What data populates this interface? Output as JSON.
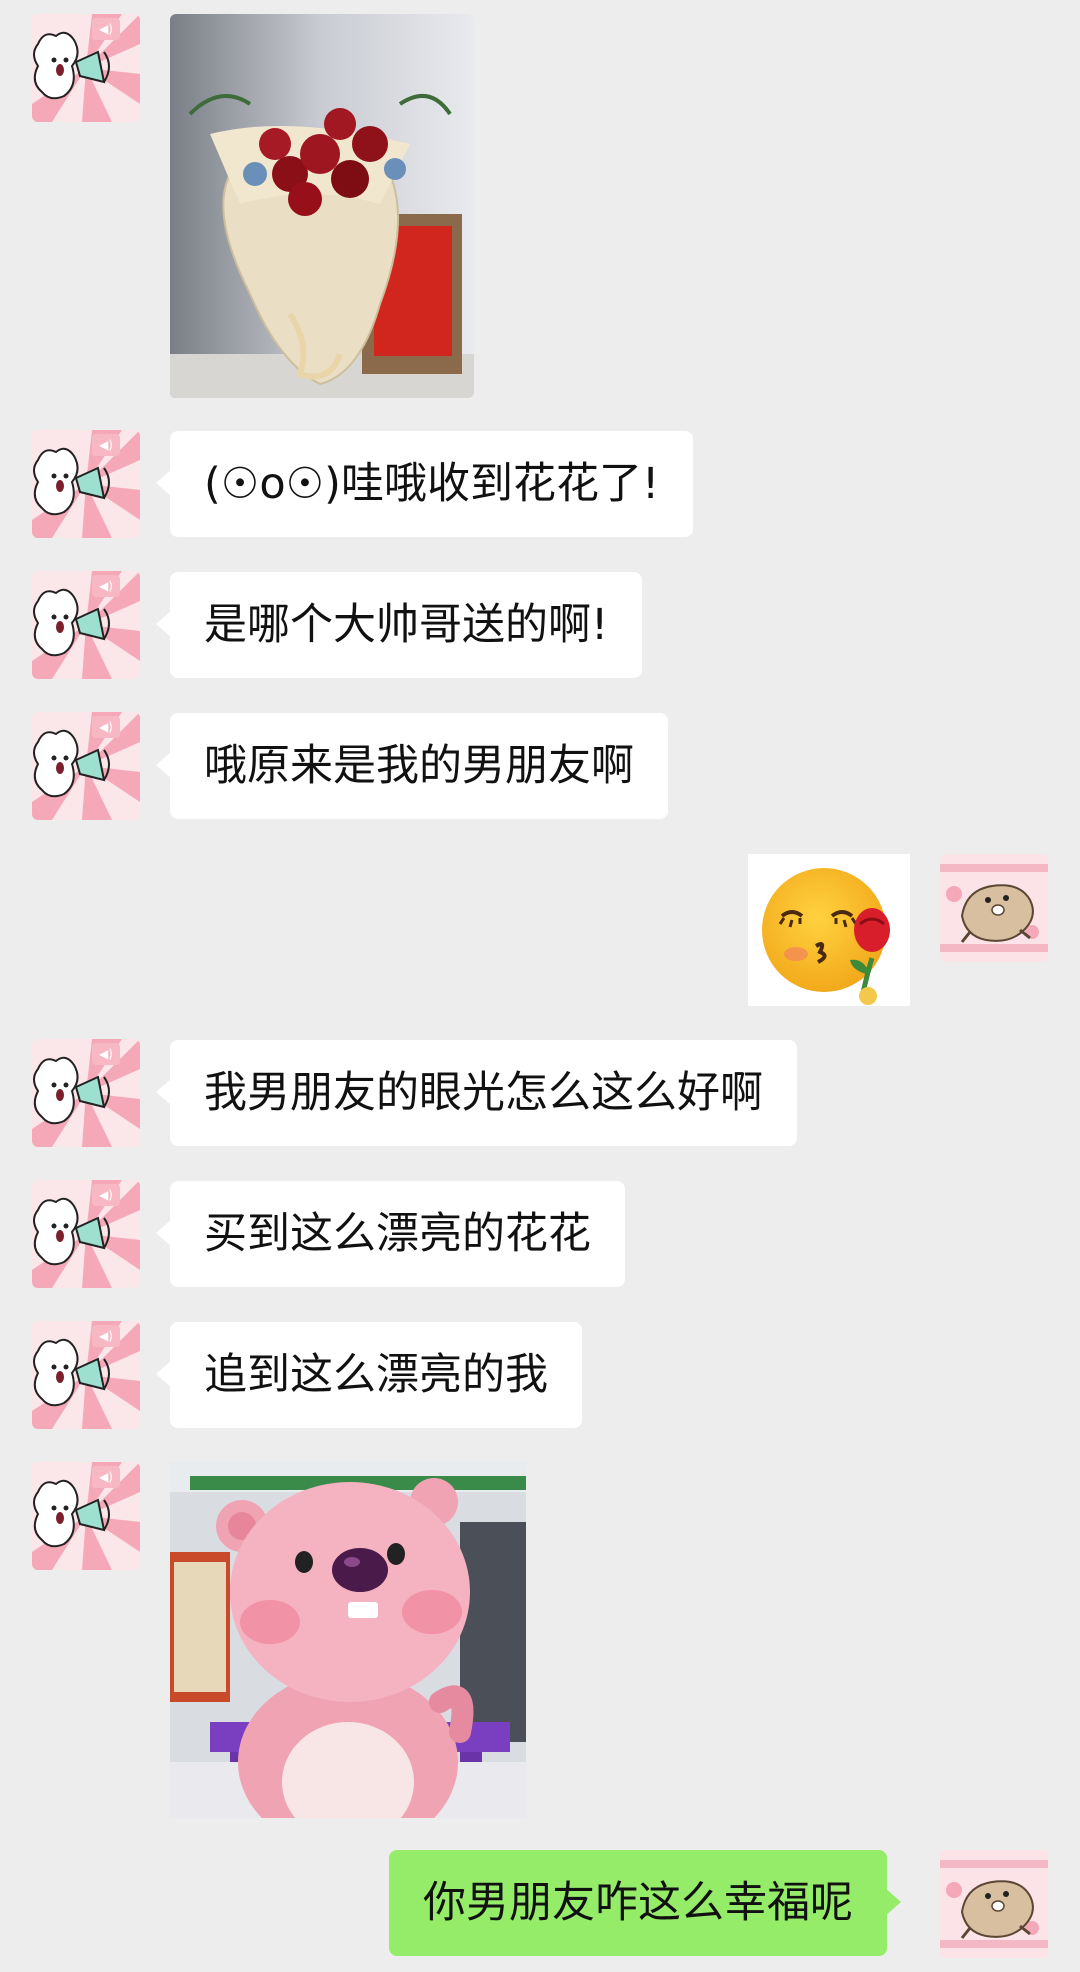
{
  "chat": {
    "messages": [
      {
        "side": "left",
        "type": "image",
        "content": "flower-bouquet-photo"
      },
      {
        "side": "left",
        "type": "text",
        "text": "(☉o☉)哇哦收到花花了!"
      },
      {
        "side": "left",
        "type": "text",
        "text": "是哪个大帅哥送的啊!"
      },
      {
        "side": "left",
        "type": "text",
        "text": "哦原来是我的男朋友啊"
      },
      {
        "side": "right",
        "type": "sticker",
        "content": "kiss-rose-emoji"
      },
      {
        "side": "left",
        "type": "text",
        "text": "我男朋友的眼光怎么这么好啊"
      },
      {
        "side": "left",
        "type": "text",
        "text": "买到这么漂亮的花花"
      },
      {
        "side": "left",
        "type": "text",
        "text": "追到这么漂亮的我"
      },
      {
        "side": "left",
        "type": "image",
        "content": "pink-beaver-sticker"
      },
      {
        "side": "right",
        "type": "text",
        "text": "你男朋友咋这么幸福呢"
      }
    ]
  },
  "colors": {
    "background": "#ededed",
    "bubble_left": "#ffffff",
    "bubble_right": "#95ec69",
    "avatar_left_bg": "#f7c9d3",
    "avatar_right_bg": "#f7d0d8"
  },
  "icons": {
    "left_avatar": "alpaca-megaphone-avatar",
    "right_avatar": "hamster-avatar"
  }
}
